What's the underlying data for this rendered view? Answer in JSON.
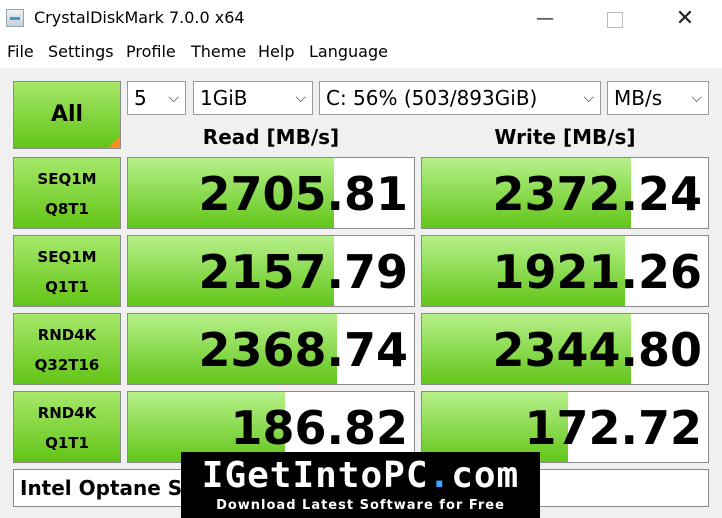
{
  "window": {
    "title": "CrystalDiskMark 7.0.0 x64",
    "controls": {
      "minimize": "—",
      "maximize": "",
      "close": "✕"
    }
  },
  "menu": [
    "File",
    "Settings",
    "Profile",
    "Theme",
    "Help",
    "Language"
  ],
  "controls": {
    "all_label": "All",
    "count": "5",
    "size": "1GiB",
    "drive": "C: 56% (503/893GiB)",
    "unit": "MB/s",
    "chevron": "⌵"
  },
  "headers": {
    "read": "Read [MB/s]",
    "write": "Write [MB/s]"
  },
  "tests": [
    {
      "line1": "SEQ1M",
      "line2": "Q8T1",
      "read": "2705.81",
      "write": "2372.24",
      "read_fill": 0.72,
      "write_fill": 0.73
    },
    {
      "line1": "SEQ1M",
      "line2": "Q1T1",
      "read": "2157.79",
      "write": "1921.26",
      "read_fill": 0.72,
      "write_fill": 0.71
    },
    {
      "line1": "RND4K",
      "line2": "Q32T16",
      "read": "2368.74",
      "write": "2344.80",
      "read_fill": 0.73,
      "write_fill": 0.73
    },
    {
      "line1": "RND4K",
      "line2": "Q1T1",
      "read": "186.82",
      "write": "172.72",
      "read_fill": 0.55,
      "write_fill": 0.51
    }
  ],
  "comment": "Intel Optane S",
  "watermark": {
    "brand_main": "IGetIntoPC",
    "brand_dot": ".",
    "brand_tld": "com",
    "tagline": "Download Latest Software for Free"
  },
  "colors": {
    "accent_green": "#63c417",
    "orange_corner": "#ff8a1f",
    "watermark_blue": "#3aa6ff"
  }
}
